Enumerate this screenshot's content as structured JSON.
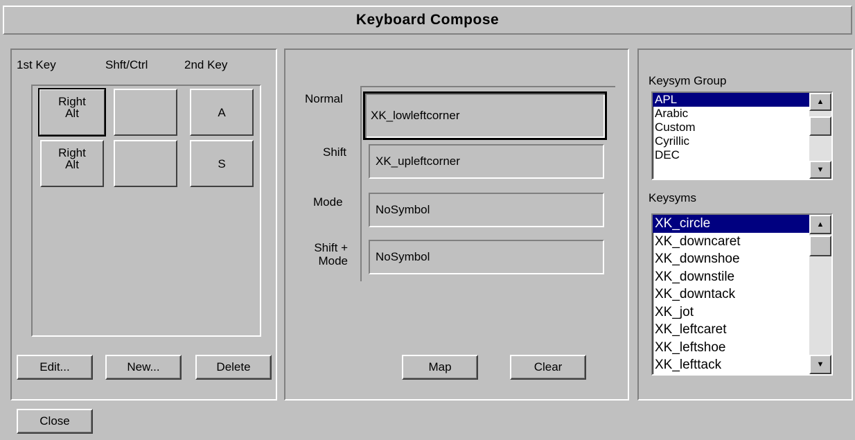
{
  "window": {
    "title": "Keyboard Compose"
  },
  "compose_list": {
    "headers": {
      "first_key": "1st Key",
      "shift_ctrl": "Shft/Ctrl",
      "second_key": "2nd Key"
    },
    "rows": [
      {
        "first_key_line1": "Right",
        "first_key_line2": "Alt",
        "shift_ctrl": "",
        "second_key": "A"
      },
      {
        "first_key_line1": "Right",
        "first_key_line2": "Alt",
        "shift_ctrl": "",
        "second_key": "S"
      }
    ],
    "buttons": {
      "edit": "Edit...",
      "new": "New...",
      "delete": "Delete"
    }
  },
  "mapping": {
    "rows": [
      {
        "label": "Normal",
        "value": "XK_lowleftcorner"
      },
      {
        "label": "Shift",
        "value": "XK_upleftcorner"
      },
      {
        "label": "Mode",
        "value": "NoSymbol"
      },
      {
        "label_line1": "Shift +",
        "label_line2": "Mode",
        "value": "NoSymbol"
      }
    ],
    "buttons": {
      "map": "Map",
      "clear": "Clear"
    }
  },
  "keysym_group": {
    "label": "Keysym Group",
    "items": [
      "APL",
      "Arabic",
      "Custom",
      "Cyrillic",
      "DEC"
    ],
    "selected": "APL"
  },
  "keysyms": {
    "label": "Keysyms",
    "items": [
      "XK_circle",
      "XK_downcaret",
      "XK_downshoe",
      "XK_downstile",
      "XK_downtack",
      "XK_jot",
      "XK_leftcaret",
      "XK_leftshoe",
      "XK_lefttack"
    ],
    "selected": "XK_circle"
  },
  "footer": {
    "close": "Close"
  },
  "colors": {
    "face": "#c0c0c0",
    "selection": "#000080",
    "highlight": "#ffffff",
    "shadow": "#808080"
  },
  "icons": {
    "scroll_up": "up-arrow-icon",
    "scroll_down": "down-arrow-icon"
  }
}
